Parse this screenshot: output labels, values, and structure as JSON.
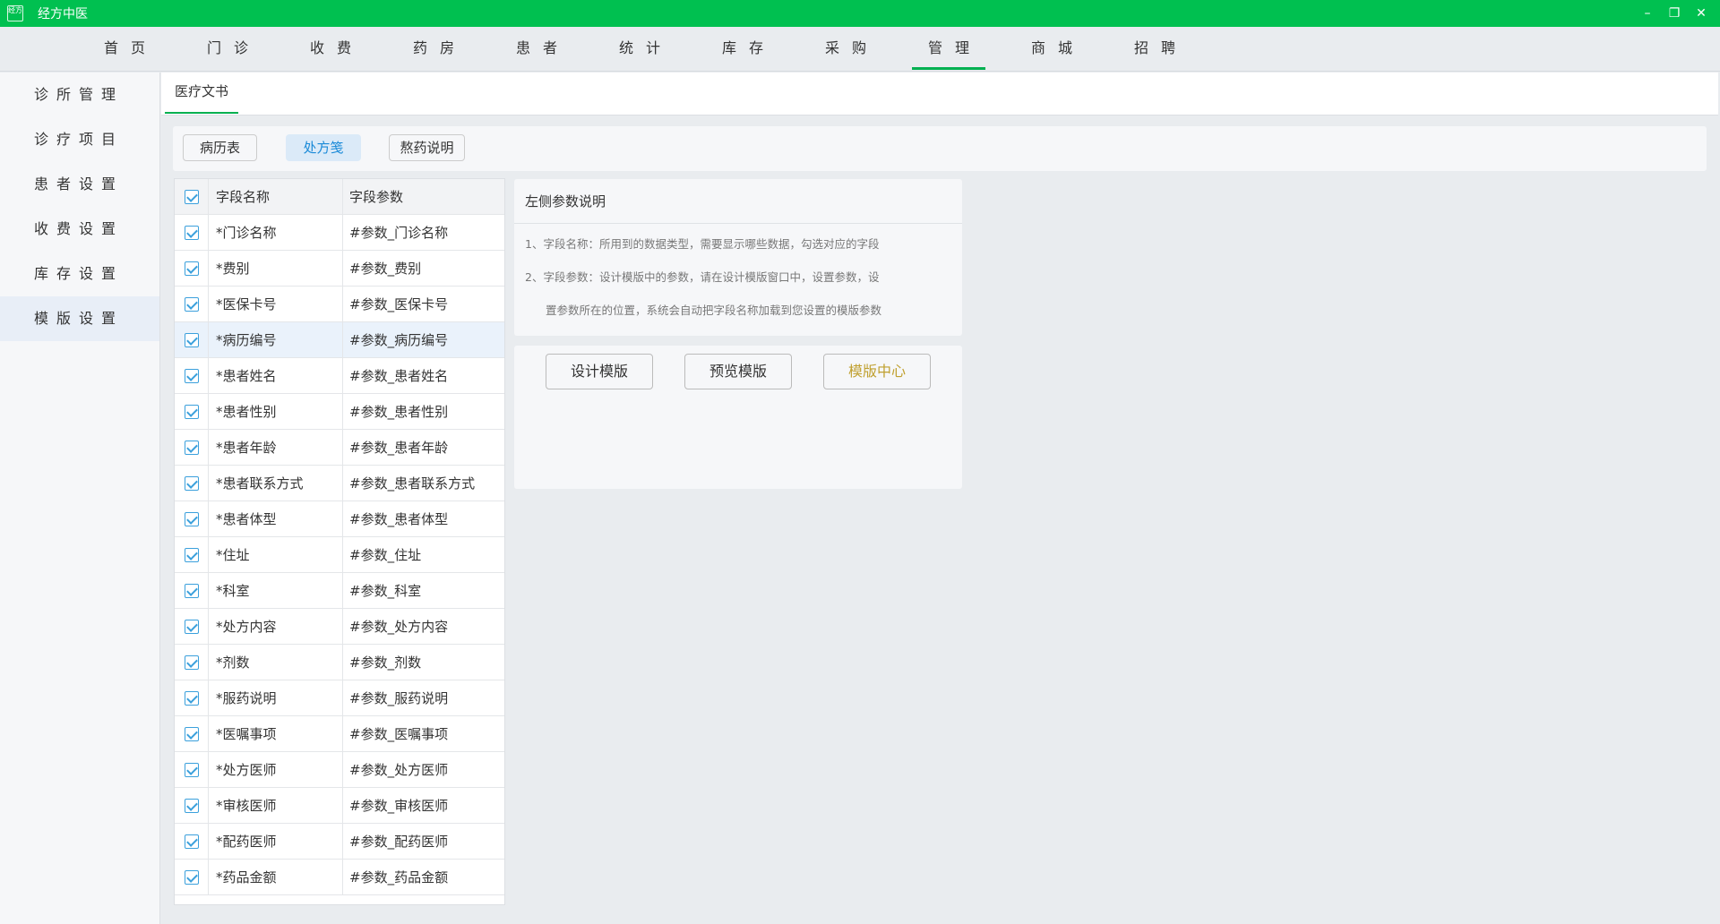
{
  "window": {
    "logo_text": "经方",
    "title": "经方中医",
    "controls": {
      "minimize": "–",
      "restore": "❐",
      "close": "✕"
    }
  },
  "nav": {
    "items": [
      "首页",
      "门诊",
      "收费",
      "药房",
      "患者",
      "统计",
      "库存",
      "采购",
      "管理",
      "商城",
      "招聘"
    ],
    "active": "管理"
  },
  "sidebar": {
    "items": [
      "诊所管理",
      "诊疗项目",
      "患者设置",
      "收费设置",
      "库存设置",
      "模版设置"
    ],
    "active": "模版设置"
  },
  "content": {
    "tab_label": "医疗文书"
  },
  "template_types": {
    "items": [
      "病历表",
      "处方笺",
      "熬药说明"
    ],
    "active": "处方笺"
  },
  "field_table": {
    "headers": {
      "name": "字段名称",
      "param": "字段参数"
    },
    "rows": [
      {
        "name": "*门诊名称",
        "param": "#参数_门诊名称",
        "checked": true
      },
      {
        "name": "*费别",
        "param": "#参数_费别",
        "checked": true
      },
      {
        "name": "*医保卡号",
        "param": "#参数_医保卡号",
        "checked": true
      },
      {
        "name": "*病历编号",
        "param": "#参数_病历编号",
        "checked": true
      },
      {
        "name": "*患者姓名",
        "param": "#参数_患者姓名",
        "checked": true
      },
      {
        "name": "*患者性别",
        "param": "#参数_患者性别",
        "checked": true
      },
      {
        "name": "*患者年龄",
        "param": "#参数_患者年龄",
        "checked": true
      },
      {
        "name": "*患者联系方式",
        "param": "#参数_患者联系方式",
        "checked": true
      },
      {
        "name": "*患者体型",
        "param": "#参数_患者体型",
        "checked": true
      },
      {
        "name": "*住址",
        "param": "#参数_住址",
        "checked": true
      },
      {
        "name": "*科室",
        "param": "#参数_科室",
        "checked": true
      },
      {
        "name": "*处方内容",
        "param": "#参数_处方内容",
        "checked": true
      },
      {
        "name": "*剂数",
        "param": "#参数_剂数",
        "checked": true
      },
      {
        "name": "*服药说明",
        "param": "#参数_服药说明",
        "checked": true
      },
      {
        "name": "*医嘱事项",
        "param": "#参数_医嘱事项",
        "checked": true
      },
      {
        "name": "*处方医师",
        "param": "#参数_处方医师",
        "checked": true
      },
      {
        "name": "*审核医师",
        "param": "#参数_审核医师",
        "checked": true
      },
      {
        "name": "*配药医师",
        "param": "#参数_配药医师",
        "checked": true
      },
      {
        "name": "*药品金额",
        "param": "#参数_药品金额",
        "checked": true
      }
    ],
    "highlighted_row": "*病历编号"
  },
  "description": {
    "title": "左侧参数说明",
    "lines": [
      "1、字段名称：所用到的数据类型，需要显示哪些数据，勾选对应的字段",
      "2、字段参数：设计模版中的参数，请在设计模版窗口中，设置参数，设",
      "置参数所在的位置，系统会自动把字段名称加载到您设置的模版参数"
    ]
  },
  "actions": {
    "design": "设计模版",
    "preview": "预览模版",
    "center": "模版中心"
  },
  "colors": {
    "brand_green": "#00c050",
    "active_blue": "#1a8ad8",
    "checkbox_blue": "#3ba0dc",
    "gold_text": "#c0a030"
  }
}
